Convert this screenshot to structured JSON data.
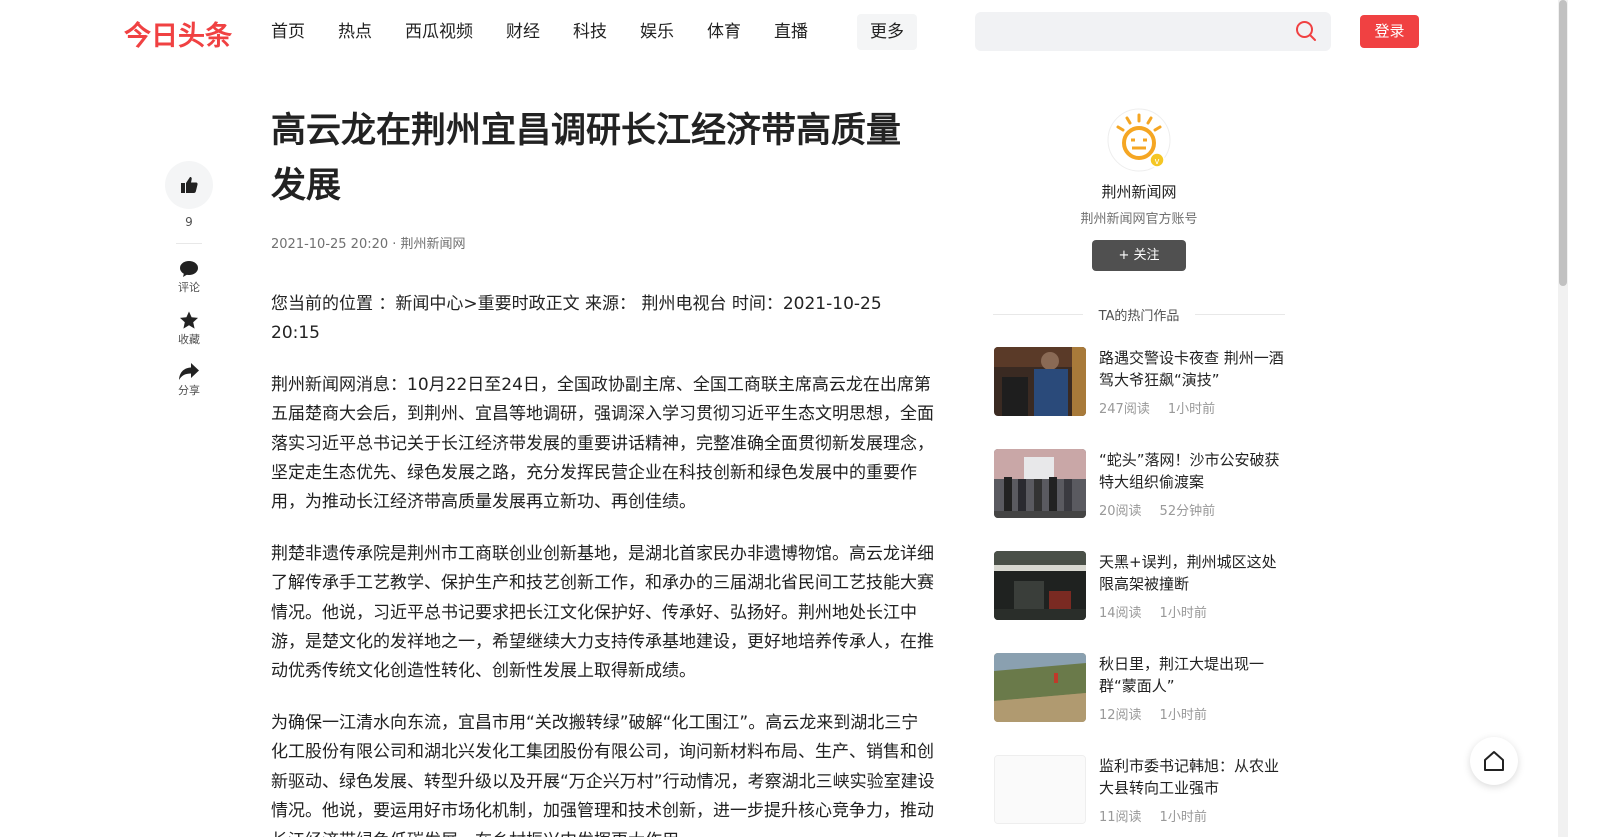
{
  "header": {
    "logo": "今日头条",
    "nav": [
      "首页",
      "热点",
      "西瓜视频",
      "财经",
      "科技",
      "娱乐",
      "体育",
      "直播"
    ],
    "more": "更多",
    "search_placeholder": "",
    "login": "登录"
  },
  "actions": {
    "like_count": "9",
    "comment": "评论",
    "collect": "收藏",
    "share": "分享"
  },
  "article": {
    "title": "高云龙在荆州宜昌调研长江经济带高质量发展",
    "meta": "2021-10-25 20:20 · 荆州新闻网",
    "paragraphs": [
      "您当前的位置 ：新闻中心>重要时政正文 来源： 荆州电视台 时间：2021-10-25 20:15",
      "荆州新闻网消息：10月22日至24日，全国政协副主席、全国工商联主席高云龙在出席第五届楚商大会后，到荆州、宜昌等地调研，强调深入学习贯彻习近平生态文明思想，全面落实习近平总书记关于长江经济带发展的重要讲话精神，完整准确全面贯彻新发展理念，坚定走生态优先、绿色发展之路，充分发挥民营企业在科技创新和绿色发展中的重要作用，为推动长江经济带高质量发展再立新功、再创佳绩。",
      "荆楚非遗传承院是荆州市工商联创业创新基地，是湖北首家民办非遗博物馆。高云龙详细了解传承手工艺教学、保护生产和技艺创新工作，和承办的三届湖北省民间工艺技能大赛情况。他说，习近平总书记要求把长江文化保护好、传承好、弘扬好。荆州地处长江中游，是楚文化的发祥地之一，希望继续大力支持传承基地建设，更好地培养传承人，在推动优秀传统文化创造性转化、创新性发展上取得新成绩。",
      "为确保一江清水向东流，宜昌市用“关改搬转绿”破解“化工围江”。高云龙来到湖北三宁化工股份有限公司和湖北兴发化工集团股份有限公司，询问新材料布局、生产、销售和创新驱动、绿色发展、转型升级以及开展“万企兴万村”行动情况，考察湖北三峡实验室建设情况。他说，要运用好市场化机制，加强管理和技术创新，进一步提升核心竞争力，推动长江经济带绿色低碳发展，在乡村振兴中发挥更大作用。"
    ]
  },
  "author": {
    "name": "荆州新闻网",
    "desc": "荆州新闻网官方账号",
    "follow": "+ 关注"
  },
  "hot": {
    "title": "TA的热门作品",
    "items": [
      {
        "text": "路遇交警设卡夜查 荆州一酒驾大爷狂飙“演技”",
        "reads": "247阅读",
        "time": "1小时前"
      },
      {
        "text": "“蛇头”落网！沙市公安破获特大组织偷渡案",
        "reads": "20阅读",
        "time": "52分钟前"
      },
      {
        "text": "天黑+误判，荆州城区这处限高架被撞断",
        "reads": "14阅读",
        "time": "1小时前"
      },
      {
        "text": "秋日里，荆江大堤出现一群“蒙面人”",
        "reads": "12阅读",
        "time": "1小时前"
      },
      {
        "text": "监利市委书记韩旭：从农业大县转向工业强市",
        "reads": "11阅读",
        "time": "1小时前"
      }
    ]
  },
  "icons": {
    "like": "thumbs-up-icon",
    "comment": "comment-bubble-icon",
    "collect": "star-icon",
    "share": "share-arrow-icon",
    "search": "search-icon",
    "home": "home-icon"
  },
  "colors": {
    "brand": "#f04142",
    "follow_button": "#505050"
  }
}
